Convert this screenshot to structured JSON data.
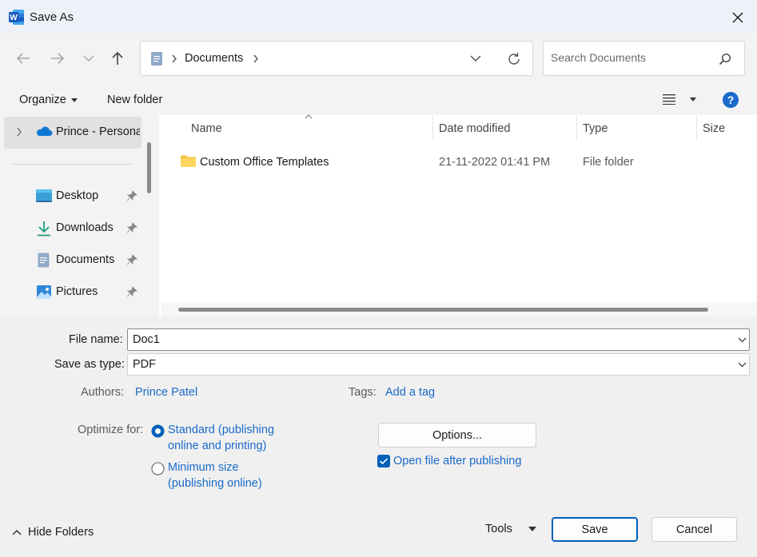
{
  "window": {
    "title": "Save As",
    "app_icon": "word-icon"
  },
  "nav": {
    "back_icon": "arrow-left-icon",
    "forward_icon": "arrow-right-icon",
    "recent_icon": "chevron-down-icon",
    "up_icon": "arrow-up-icon",
    "breadcrumb": [
      "Documents"
    ],
    "search_placeholder": "Search Documents"
  },
  "toolbar": {
    "organize_label": "Organize",
    "new_folder_label": "New folder"
  },
  "sidebar": {
    "cloud_item": "Prince - Persona",
    "items": [
      {
        "label": "Desktop",
        "icon": "desktop-icon"
      },
      {
        "label": "Downloads",
        "icon": "download-icon"
      },
      {
        "label": "Documents",
        "icon": "document-icon"
      },
      {
        "label": "Pictures",
        "icon": "pictures-icon"
      }
    ]
  },
  "filelist": {
    "columns": {
      "name": "Name",
      "date": "Date modified",
      "type": "Type",
      "size": "Size"
    },
    "rows": [
      {
        "name": "Custom Office Templates",
        "date": "21-11-2022 01:41 PM",
        "type": "File folder",
        "size": ""
      }
    ]
  },
  "form": {
    "file_name_label": "File name:",
    "file_name_value": "Doc1",
    "type_label": "Save as type:",
    "type_value": "PDF",
    "authors_label": "Authors:",
    "authors_value": "Prince Patel",
    "tags_label": "Tags:",
    "tags_value": "Add a tag",
    "optimize_label": "Optimize for:",
    "opt_standard_line1": "Standard (publishing",
    "opt_standard_line2": "online and printing)",
    "opt_minimum_line1": "Minimum size",
    "opt_minimum_line2": "(publishing online)",
    "options_button": "Options...",
    "open_after_label": "Open file after publishing"
  },
  "footer": {
    "hide_folders": "Hide Folders",
    "tools": "Tools",
    "save": "Save",
    "cancel": "Cancel"
  },
  "colors": {
    "accent": "#005fb8",
    "link": "#1a6ac9",
    "folder": "#f4c542"
  }
}
